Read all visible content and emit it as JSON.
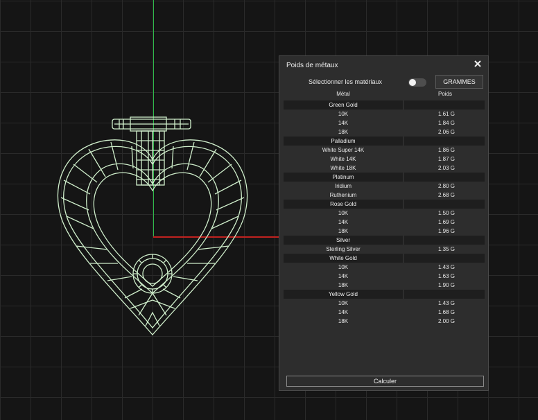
{
  "panel": {
    "title": "Poids de métaux",
    "select_label": "Sélectionner les matériaux",
    "units_button": "GRAMMES",
    "col_metal": "Métal",
    "col_weight": "Poids",
    "calc_button": "Calculer"
  },
  "groups": [
    {
      "name": "Green Gold",
      "items": [
        {
          "metal": "10K",
          "weight": "1.61 G"
        },
        {
          "metal": "14K",
          "weight": "1.84 G"
        },
        {
          "metal": "18K",
          "weight": "2.06 G"
        }
      ]
    },
    {
      "name": "Palladium",
      "items": [
        {
          "metal": "White Super 14K",
          "weight": "1.86 G"
        },
        {
          "metal": "White 14K",
          "weight": "1.87 G"
        },
        {
          "metal": "White 18K",
          "weight": "2.03 G"
        }
      ]
    },
    {
      "name": "Platinum",
      "items": [
        {
          "metal": "Iridium",
          "weight": "2.80 G"
        },
        {
          "metal": "Ruthenium",
          "weight": "2.68 G"
        }
      ]
    },
    {
      "name": "Rose Gold",
      "items": [
        {
          "metal": "10K",
          "weight": "1.50 G"
        },
        {
          "metal": "14K",
          "weight": "1.69 G"
        },
        {
          "metal": "18K",
          "weight": "1.96 G"
        }
      ]
    },
    {
      "name": "Silver",
      "items": [
        {
          "metal": "Sterling Silver",
          "weight": "1.35 G"
        }
      ]
    },
    {
      "name": "White Gold",
      "items": [
        {
          "metal": "10K",
          "weight": "1.43 G"
        },
        {
          "metal": "14K",
          "weight": "1.63 G"
        },
        {
          "metal": "18K",
          "weight": "1.90 G"
        }
      ]
    },
    {
      "name": "Yellow Gold",
      "items": [
        {
          "metal": "10K",
          "weight": "1.43 G"
        },
        {
          "metal": "14K",
          "weight": "1.68 G"
        },
        {
          "metal": "18K",
          "weight": "2.00 G"
        }
      ]
    }
  ],
  "colors": {
    "background": "#151515",
    "wireframe": "#cfeecb",
    "axis_y": "#2fb84a",
    "axis_x": "#c0221f",
    "panel_bg": "#2d2d2d"
  }
}
